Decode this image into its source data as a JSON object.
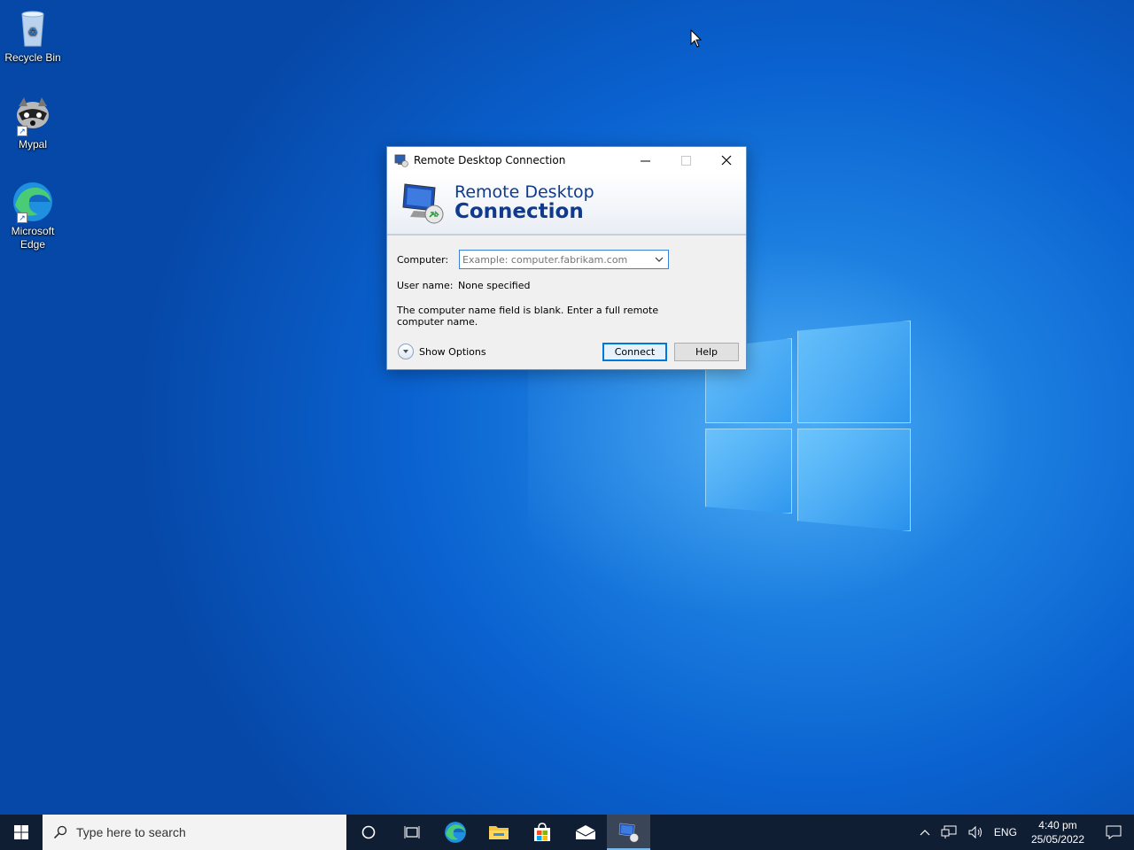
{
  "desktop": {
    "icons": [
      {
        "label": "Recycle Bin",
        "icon": "recycle-bin-icon"
      },
      {
        "label": "Mypal",
        "icon": "raccoon-icon"
      },
      {
        "label": "Microsoft Edge",
        "icon": "edge-icon"
      }
    ]
  },
  "dialog": {
    "title": "Remote Desktop Connection",
    "banner_line1": "Remote Desktop",
    "banner_line2": "Connection",
    "computer_label": "Computer:",
    "computer_placeholder": "Example: computer.fabrikam.com",
    "computer_value": "",
    "username_label": "User name:",
    "username_value": "None specified",
    "message": "The computer name field is blank. Enter a full remote computer name.",
    "show_options": "Show Options",
    "connect": "Connect",
    "help": "Help"
  },
  "taskbar": {
    "search_placeholder": "Type here to search",
    "language": "ENG",
    "time": "4:40 pm",
    "date": "25/05/2022"
  },
  "colors": {
    "accent": "#0078d7",
    "banner_text": "#103a8c",
    "taskbar": "#0f1e33"
  }
}
